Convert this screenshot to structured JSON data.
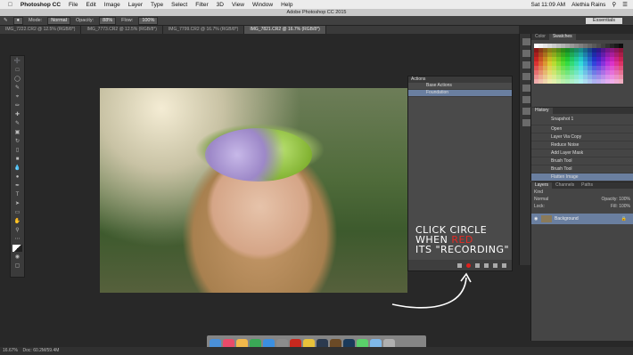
{
  "menubar": {
    "apple": "",
    "app": "Photoshop CC",
    "items": [
      "File",
      "Edit",
      "Image",
      "Layer",
      "Type",
      "Select",
      "Filter",
      "3D",
      "View",
      "Window",
      "Help"
    ],
    "clock": "Sat 11:09 AM",
    "user": "Alethia Rains"
  },
  "window_title": "Adobe Photoshop CC 2015",
  "options": {
    "mode_label": "Mode:",
    "mode_value": "Normal",
    "opacity_label": "Opacity:",
    "opacity_value": "88%",
    "flow_label": "Flow:",
    "flow_value": "100%",
    "workspace": "Essentials"
  },
  "tabs": [
    "IMG_7222.CR2 @ 12.5% (RGB/8*)",
    "IMG_7773.CR2 @ 12.5% (RGB/8*)",
    "IMG_7799.CR2 @ 16.7% (RGB/8*)",
    "IMG_7821.CR2 @ 16.7% (RGB/8*)"
  ],
  "actions": {
    "header": "Actions",
    "rows": [
      "Base Actions",
      "Foundation"
    ]
  },
  "annotation": {
    "line1": "Click circle",
    "line2a": "when ",
    "line2b": "red",
    "line3": "its \"recording\""
  },
  "color_panel": {
    "tabs": [
      "Color",
      "Swatches"
    ]
  },
  "history": {
    "header": "History",
    "snapshot": "Snapshot 1",
    "rows": [
      "Open",
      "Layer Via Copy",
      "Reduce Noise",
      "Add Layer Mask",
      "Brush Tool",
      "Brush Tool",
      "Flatten Image"
    ]
  },
  "layers": {
    "tabs": [
      "Layers",
      "Channels",
      "Paths"
    ],
    "kind": "Kind",
    "blend": "Normal",
    "opacity": "Opacity: 100%",
    "lock": "Lock:",
    "fill": "Fill: 100%",
    "background": "Background"
  },
  "status": {
    "zoom": "16.67%",
    "doc": "Doc: 60.2M/59.4M"
  },
  "colors": {
    "accent": "#6a7fa0",
    "record": "#e0201c"
  }
}
